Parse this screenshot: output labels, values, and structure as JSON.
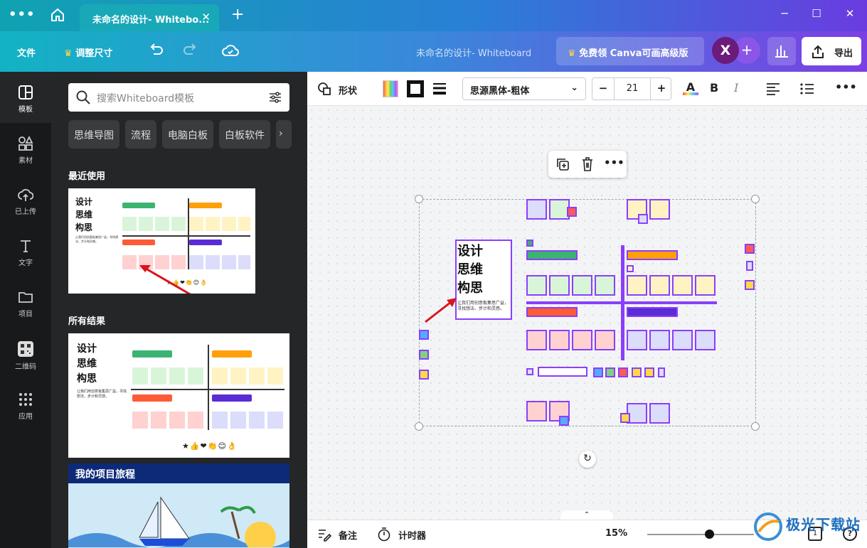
{
  "window": {
    "tab_title": "未命名的设计- Whitebo...",
    "tab_close": "✕",
    "new_tab": "+"
  },
  "menubar": {
    "file": "文件",
    "resize": "调整尺寸",
    "doc_title": "未命名的设计- Whiteboard",
    "premium": "免费领 Canva可画高级版",
    "avatar": "X",
    "export": "导出"
  },
  "rail": [
    {
      "label": "模板",
      "icon": "template-icon",
      "active": true
    },
    {
      "label": "素材",
      "icon": "elements-icon",
      "active": false
    },
    {
      "label": "已上传",
      "icon": "upload-icon",
      "active": false
    },
    {
      "label": "文字",
      "icon": "text-icon",
      "active": false
    },
    {
      "label": "项目",
      "icon": "folder-icon",
      "active": false
    },
    {
      "label": "二维码",
      "icon": "qrcode-icon",
      "active": false
    },
    {
      "label": "应用",
      "icon": "apps-icon",
      "active": false
    }
  ],
  "panel": {
    "search_placeholder": "搜索Whiteboard模板",
    "chips": [
      "思维导图",
      "流程",
      "电脑白板",
      "白板软件"
    ],
    "recent_title": "最近使用",
    "all_title": "所有结果",
    "thumb_title_1": "设计",
    "thumb_title_2": "思维",
    "thumb_title_3": "构思",
    "thumb_desc": "让我们用创意板集思广益，寻找想法、步计和灵感。",
    "journey_title": "我的项目旅程"
  },
  "toolbar": {
    "shape": "形状",
    "font": "思源黑体-粗体",
    "font_size": "21",
    "minus": "−",
    "plus": "+"
  },
  "board": {
    "title_1": "设计",
    "title_2": "思维",
    "title_3": "构思",
    "desc": "让我们用创意板集思广益，寻找想法、步计和灵感。"
  },
  "bottom": {
    "notes": "备注",
    "timer": "计时器",
    "zoom": "15%"
  },
  "watermark": "极光下载站",
  "colors": {
    "accent_purple": "#8a3ffc",
    "green": "#3cb371",
    "orange": "#ff9f0a",
    "red": "#ff5a36",
    "indigo": "#5b2bd6",
    "sticky_green": "#d9f5d9",
    "sticky_yellow": "#fff3c4",
    "sticky_pink": "#ffd1d1",
    "sticky_lavender": "#dcdcfb"
  }
}
